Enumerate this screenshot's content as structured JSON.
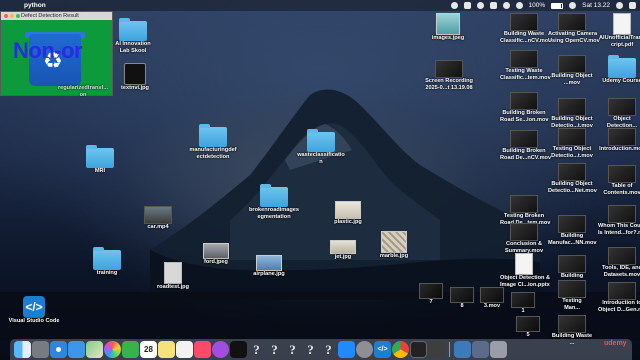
{
  "menubar": {
    "app_name": "python",
    "status": {
      "battery": "100%",
      "clock": "Sat 13.22"
    },
    "colors": {
      "bar": "#14182299"
    }
  },
  "python_window": {
    "title": "Defect Detection Result",
    "overlay_text": "Non-or",
    "colors": {
      "background": "#0c9a3d",
      "bin": "#1f6ad2",
      "text": "#2828e6"
    }
  },
  "desktop_icons": {
    "ai_innovation": {
      "label_1": "AI Innovation",
      "label_2": "Lab Skool"
    },
    "textnvi": {
      "label": "textnvi.jpg"
    },
    "regularized": {
      "label_1": "regularizedtransf...",
      "label_2": "on"
    },
    "images_jpeg": {
      "label": "images.jpeg"
    },
    "screen_recording": {
      "label_1": "Screen Recording",
      "label_2": "2025-0...t 13.19.08"
    },
    "manufacturing": {
      "label_1": "manufacturingdef",
      "label_2": "ectdetection"
    },
    "wasteclassification": {
      "label_1": "wasteclassificatio",
      "label_2": "n"
    },
    "mri": {
      "label": "MRI"
    },
    "brokenroad": {
      "label_1": "brokenroadimages",
      "label_2": "egmentation"
    },
    "car": {
      "label": "car.mp4"
    },
    "plastic": {
      "label": "plastic.jpg"
    },
    "jet": {
      "label": "jet.jpg"
    },
    "marble": {
      "label": "marble.jpg"
    },
    "ford": {
      "label": "ford.jpeg"
    },
    "airplane": {
      "label": "airplane.jpg"
    },
    "training": {
      "label": "training"
    },
    "roadtest": {
      "label": "roadtest.jpg"
    },
    "vscode": {
      "label": "Visual Studio Code"
    }
  },
  "right_column": [
    {
      "label_1": "Building Waste",
      "label_2": "Classific...nCV.mov"
    },
    {
      "label_1": "Activating Camera",
      "label_2": "Using OpenCV.mov"
    },
    {
      "label_1": "AIUnofficialTrans",
      "label_2": "cript.pdf"
    },
    {
      "label_1": "Testing Waste",
      "label_2": "Classific...tem.mov"
    },
    {
      "label_1": "Building Object",
      "label_2": "...mov"
    },
    {
      "label_1": "Udemy Course",
      "label_2": ""
    },
    {
      "label_1": "Building Broken",
      "label_2": "Road Se...ion.mov"
    },
    {
      "label_1": "Building Object",
      "label_2": "Detectio...t.mov"
    },
    {
      "label_1": "Object",
      "label_2": "Detection..."
    },
    {
      "label_1": "Building Broken",
      "label_2": "Road De...nCV.mov"
    },
    {
      "label_1": "Testing Object",
      "label_2": "Detectio...t.mov"
    },
    {
      "label_1": "Introduction.mov",
      "label_2": ""
    },
    {
      "label_1": "Building Object",
      "label_2": "Detectio...Net.mov"
    },
    {
      "label_1": "Table of",
      "label_2": "Contents.mov"
    },
    {
      "label_1": "Testing Broken",
      "label_2": "Road De...tem.mov"
    },
    {
      "label_1": "Conclusion &",
      "label_2": "Summary.mov"
    },
    {
      "label_1": "Building",
      "label_2": "Manufac...NN.mov"
    },
    {
      "label_1": "Whom This Course",
      "label_2": "Is Intend...for?.mov"
    },
    {
      "label_1": "Object Detection &",
      "label_2": "Image Cl...ion.pptx"
    },
    {
      "label_1": "Building",
      "label_2": "..."
    },
    {
      "label_1": "Tools, IDE, and",
      "label_2": "Datasets.mov"
    },
    {
      "label_1": "Testing",
      "label_2": "Man..."
    },
    {
      "label_1": "Introduction to",
      "label_2": "Object D...Gen.mov"
    },
    {
      "label_1": "Building Waste",
      "label_2": "..."
    }
  ],
  "bottom_row": [
    {
      "label": "7"
    },
    {
      "label": "8"
    },
    {
      "label": "3.mov"
    },
    {
      "label": "1"
    },
    {
      "label": "5"
    }
  ],
  "dock": {
    "items": [
      "finder-icon",
      "launchpad-icon",
      "safari-icon",
      "mail-icon",
      "maps-icon",
      "photos-icon",
      "facetime-icon",
      "calendar-icon",
      "notes-icon",
      "reminders-icon",
      "music-icon",
      "podcasts-icon",
      "tv-icon",
      "unknown-app-1",
      "unknown-app-2",
      "unknown-app-3",
      "unknown-app-4",
      "unknown-app-5",
      "appstore-icon",
      "settings-icon",
      "vscode-icon",
      "chrome-icon",
      "terminal-icon",
      "screenshot-icon",
      "python-icon",
      "trash-icon"
    ],
    "calendar_day": "28",
    "unknown_glyph": "?"
  },
  "watermark": "udemy"
}
